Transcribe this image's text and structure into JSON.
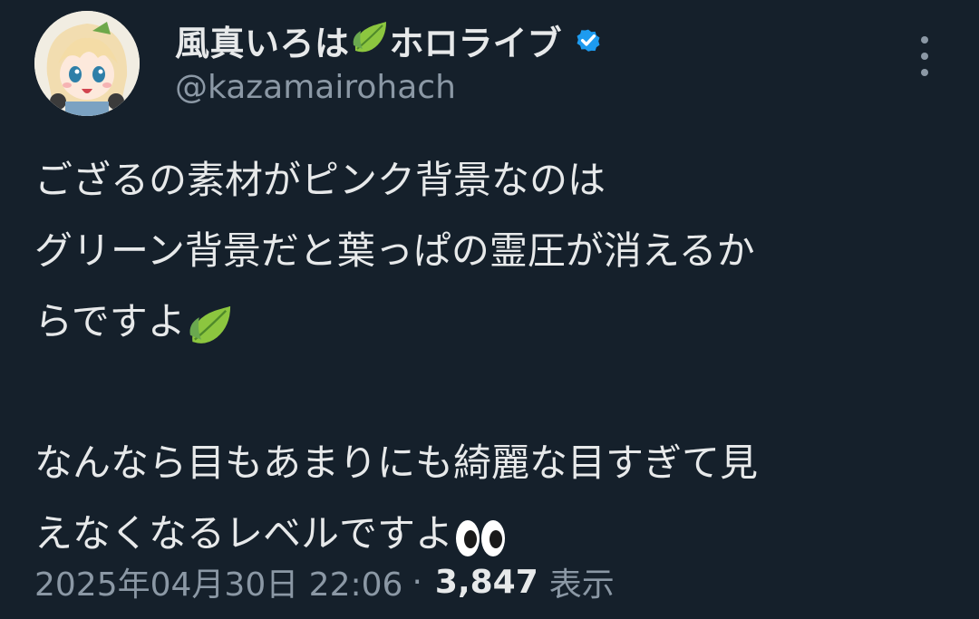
{
  "author": {
    "display_name": "風真いろは",
    "name_suffix": "ホロライブ",
    "name_emoji": "leaf-icon",
    "verified": true,
    "handle": "@kazamairohach"
  },
  "tweet": {
    "line1": "ござるの素材がピンク背景なのは",
    "line2": "グリーン背景だと葉っぱの霊圧が消えるか",
    "line3": "らですよ",
    "line4": "なんなら目もあまりにも綺麗な目すぎて見",
    "line5": "えなくなるレベルですよ",
    "line3_emoji": "leaf-icon",
    "line5_emoji": "eyes-icon"
  },
  "meta": {
    "timestamp": "2025年04月30日 22:06",
    "separator": "·",
    "views": "3,847",
    "views_label": "表示"
  },
  "colors": {
    "background": "#15202b",
    "text": "#e7e9ea",
    "secondary": "#8b98a5",
    "verified": "#1d9bf0",
    "leaf": "#8cc63f"
  }
}
